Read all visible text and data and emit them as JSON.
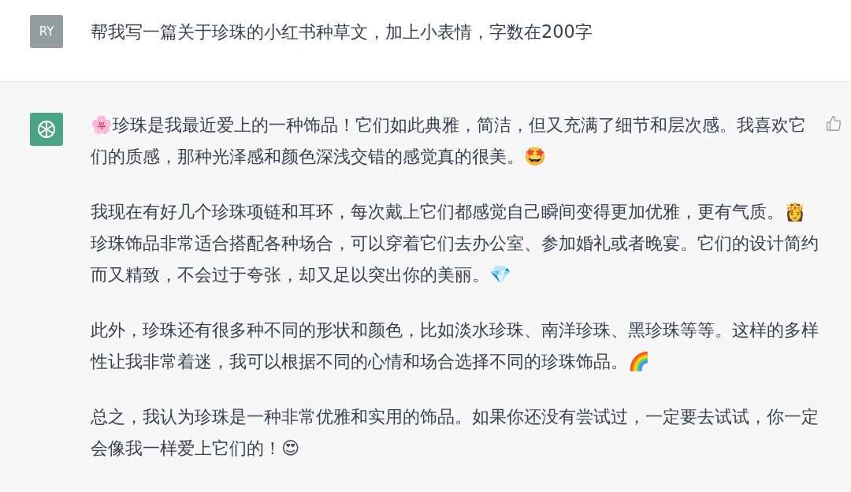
{
  "messages": [
    {
      "kind": "user",
      "avatar_text": "RY",
      "paragraphs": [
        "帮我写一篇关于珍珠的小红书种草文，加上小表情，字数在200字"
      ]
    },
    {
      "kind": "assistant",
      "paragraphs": [
        "🌸珍珠是我最近爱上的一种饰品！它们如此典雅，简洁，但又充满了细节和层次感。我喜欢它们的质感，那种光泽感和颜色深浅交错的感觉真的很美。🤩",
        "我现在有好几个珍珠项链和耳环，每次戴上它们都感觉自己瞬间变得更加优雅，更有气质。👸珍珠饰品非常适合搭配各种场合，可以穿着它们去办公室、参加婚礼或者晚宴。它们的设计简约而又精致，不会过于夸张，却又足以突出你的美丽。💎",
        "此外，珍珠还有很多种不同的形状和颜色，比如淡水珍珠、南洋珍珠、黑珍珠等等。这样的多样性让我非常着迷，我可以根据不同的心情和场合选择不同的珍珠饰品。🌈",
        "总之，我认为珍珠是一种非常优雅和实用的饰品。如果你还没有尝试过，一定要去试试，你一定会像我一样爱上它们的！😍"
      ]
    }
  ]
}
